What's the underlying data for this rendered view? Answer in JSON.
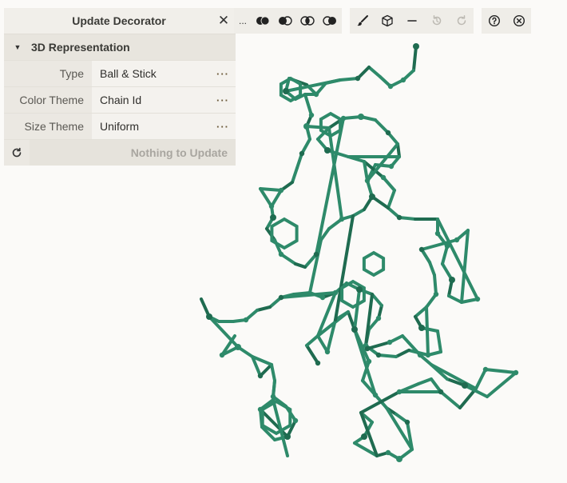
{
  "panel": {
    "title": "Update Decorator",
    "section_title": "3D Representation",
    "rows": [
      {
        "label": "Type",
        "value": "Ball & Stick",
        "more": "···"
      },
      {
        "label": "Color Theme",
        "value": "Chain Id",
        "more": "···"
      },
      {
        "label": "Size Theme",
        "value": "Uniform",
        "more": "···"
      }
    ],
    "update_label": "Nothing to Update"
  },
  "toolbar": {
    "truncated_label": "..."
  },
  "icons": {
    "close": "close-icon",
    "caret": "caret-down-icon",
    "refresh": "refresh-icon",
    "toggles": [
      "overlap-both-icon",
      "overlap-left-icon",
      "overlap-intersect-icon",
      "overlap-right-icon"
    ],
    "actions": [
      "brush-icon",
      "cube-icon",
      "minus-icon",
      "undo-icon",
      "redo-icon"
    ],
    "help": "help-icon",
    "exit": "exit-icon"
  },
  "colors": {
    "molecule": "#2e8a6a",
    "molecule_dark": "#1f6b50",
    "panel_bg": "#f1efea"
  }
}
